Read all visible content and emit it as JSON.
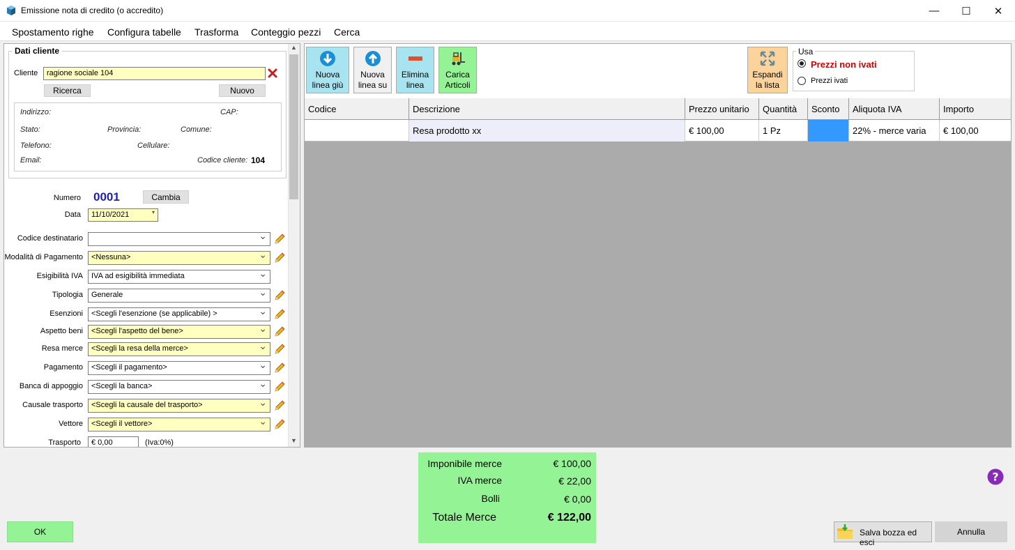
{
  "window": {
    "title": "Emissione nota di credito (o accredito)",
    "minimize": "—",
    "maximize": "☐",
    "close": "✕"
  },
  "menu": [
    "Spostamento righe",
    "Configura tabelle",
    "Trasforma",
    "Conteggio pezzi",
    "Cerca"
  ],
  "client": {
    "group_title": "Dati cliente",
    "label": "Cliente",
    "value": "ragione sociale 104",
    "search_button": "Ricerca",
    "new_button": "Nuovo",
    "address_label": "Indirizzo:",
    "cap_label": "CAP:",
    "state_label": "Stato:",
    "province_label": "Provincia:",
    "comune_label": "Comune:",
    "phone_label": "Telefono:",
    "mobile_label": "Cellulare:",
    "email_label": "Email:",
    "code_label": "Codice cliente:",
    "code_value": "104"
  },
  "document": {
    "number_label": "Numero",
    "number_value": "0001",
    "change_button": "Cambia",
    "date_label": "Data",
    "date_value": "11/10/2021"
  },
  "fields": [
    {
      "label": "Codice destinatario",
      "value": ""
    },
    {
      "label": "Modalità di Pagamento",
      "value": "<Nessuna>"
    },
    {
      "label": "Esigibilità IVA",
      "value": "IVA ad esigibilità immediata"
    },
    {
      "label": "Tipologia",
      "value": "Generale"
    },
    {
      "label": "Esenzioni",
      "value": "<Scegli l'esenzione (se applicabile) >"
    },
    {
      "label": "Aspetto beni",
      "value": "<Scegli l'aspetto del bene>"
    },
    {
      "label": "Resa merce",
      "value": "<Scegli la resa della merce>"
    },
    {
      "label": "Pagamento",
      "value": "<Scegli il pagamento>"
    },
    {
      "label": "Banca di appoggio",
      "value": "<Scegli la banca>"
    },
    {
      "label": "Causale trasporto",
      "value": "<Scegli la causale del trasporto>"
    },
    {
      "label": "Vettore",
      "value": "<Scegli il vettore>"
    }
  ],
  "transport": {
    "label": "Trasporto",
    "value": "€ 0,00",
    "vat_note": "(Iva:0%)"
  },
  "toolbar": {
    "new_line_down": [
      "Nuova",
      "linea giù"
    ],
    "new_line_up": [
      "Nuova",
      "linea su"
    ],
    "delete_line": [
      "Elimina",
      "linea"
    ],
    "load_items": [
      "Carica",
      "Articoli"
    ],
    "expand_list": [
      "Espandi",
      "la lista"
    ]
  },
  "use_prices": {
    "title": "Usa",
    "option_net": "Prezzi non ivati",
    "option_gross": "Prezzi ivati",
    "selected": "net"
  },
  "grid": {
    "headers": [
      "Codice",
      "Descrizione",
      "Prezzo unitario",
      "Quantità",
      "Sconto",
      "Aliquota IVA",
      "Importo"
    ],
    "rows": [
      [
        "",
        "Resa prodotto xx",
        "€ 100,00",
        "1 Pz",
        "",
        "22% - merce varia",
        "€ 100,00"
      ]
    ]
  },
  "totals": {
    "taxable_label": "Imponibile merce",
    "taxable_value": "€ 100,00",
    "vat_label": "IVA merce",
    "vat_value": "€ 22,00",
    "stamps_label": "Bolli",
    "stamps_value": "€ 0,00",
    "total_label": "Totale Merce",
    "total_value": "€ 122,00"
  },
  "buttons": {
    "ok": "OK",
    "save_draft": "Salva bozza ed esci",
    "cancel": "Annulla"
  },
  "colors": {
    "accent_green": "#94f394",
    "field_yellow": "#ffffc0",
    "number_blue": "#1f1fb4",
    "red_text": "#d40000",
    "sconto_blue": "#3399ff"
  }
}
